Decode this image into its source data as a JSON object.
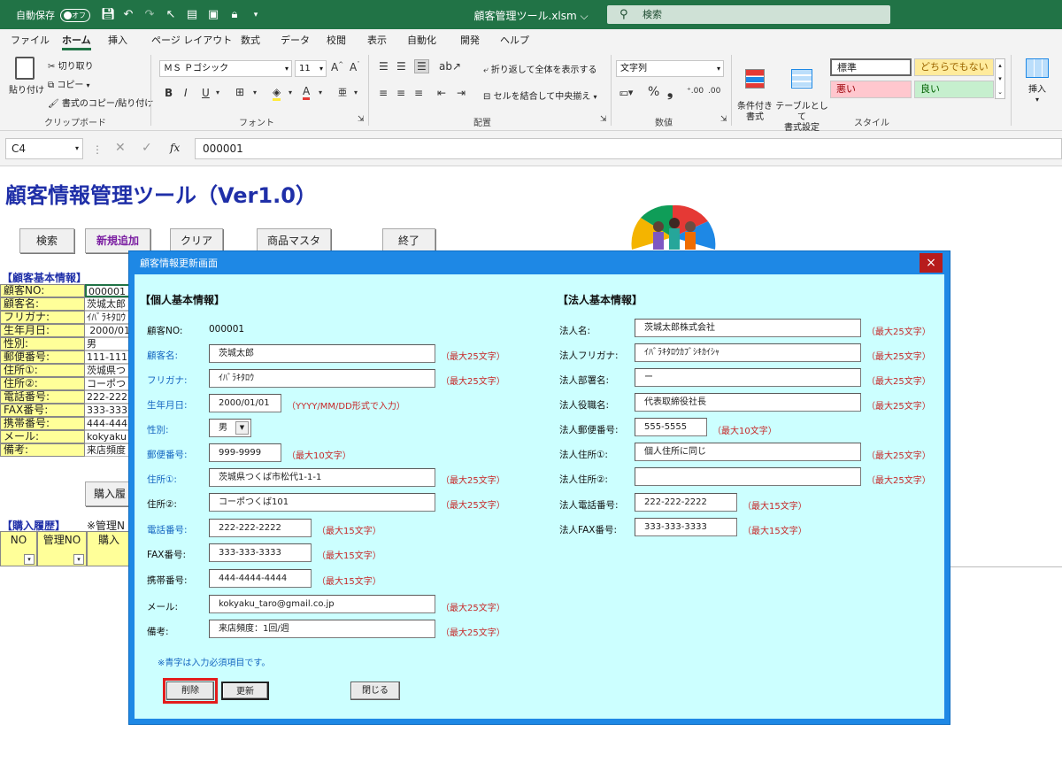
{
  "titlebar": {
    "autosave_label": "自動保存",
    "autosave_state": "オフ",
    "document_title": "顧客管理ツール.xlsm ⌵",
    "search_placeholder": "検索",
    "bg_color": "#217346"
  },
  "menu": {
    "tabs": [
      "ファイル",
      "ホーム",
      "挿入",
      "ページ レイアウト",
      "数式",
      "データ",
      "校閲",
      "表示",
      "自動化",
      "開発",
      "ヘルプ"
    ],
    "active_tab": "ホーム"
  },
  "ribbon": {
    "clipboard": {
      "paste": "貼り付け",
      "cut": "切り取り",
      "copy": "コピー",
      "format_painter": "書式のコピー/貼り付け",
      "group_label": "クリップボード"
    },
    "font": {
      "font_name": "ＭＳ Ｐゴシック",
      "font_size": "11",
      "group_label": "フォント"
    },
    "alignment": {
      "wrap_text": "折り返して全体を表示する",
      "merge_center": "セルを結合して中央揃え",
      "group_label": "配置"
    },
    "number": {
      "format": "文字列",
      "group_label": "数値"
    },
    "styles": {
      "conditional": "条件付き\n書式",
      "table": "テーブルとして\n書式設定",
      "standard": "標準",
      "neutral": "どちらでもない",
      "bad": "悪い",
      "good": "良い",
      "group_label": "スタイル"
    },
    "insert": "挿入"
  },
  "formula_bar": {
    "name_box": "C4",
    "fx": "fx",
    "value": "000001"
  },
  "sheet": {
    "title": "顧客情報管理ツール（Ver1.0）",
    "buttons": [
      "検索",
      "新規追加",
      "クリア",
      "商品マスタ",
      "終了"
    ],
    "basic_section": "【顧客基本情報】",
    "rows": [
      {
        "label": "顧客NO:",
        "value": "000001"
      },
      {
        "label": "顧客名:",
        "value": "茨城太郎"
      },
      {
        "label": "フリガナ:",
        "value": "ｲﾊﾞﾗｷﾀﾛｳ"
      },
      {
        "label": "生年月日:",
        "value": "2000/01"
      },
      {
        "label": "性別:",
        "value": "男"
      },
      {
        "label": "郵便番号:",
        "value": "111-111"
      },
      {
        "label": "住所①:",
        "value": "茨城県つ"
      },
      {
        "label": "住所②:",
        "value": "コーポつ"
      },
      {
        "label": "電話番号:",
        "value": "222-222"
      },
      {
        "label": "FAX番号:",
        "value": "333-333"
      },
      {
        "label": "携帯番号:",
        "value": "444-444"
      },
      {
        "label": "メール:",
        "value": "kokyaku"
      },
      {
        "label": "備考:",
        "value": "来店頻度"
      }
    ],
    "purchase_button": "購入履",
    "history_section": "【購入履歴】",
    "history_note": "※管理N",
    "history_headers": [
      "NO",
      "管理NO",
      "購入"
    ]
  },
  "dialog": {
    "title": "顧客情報更新画面",
    "personal_section": "【個人基本情報】",
    "corporate_section": "【法人基本情報】",
    "personal": {
      "customer_no_label": "顧客NO:",
      "customer_no": "000001",
      "name_label": "顧客名:",
      "name": "茨城太郎",
      "name_hint": "（最大25文字）",
      "kana_label": "フリガナ:",
      "kana": "ｲﾊﾞﾗｷﾀﾛｳ",
      "kana_hint": "（最大25文字）",
      "birth_label": "生年月日:",
      "birth": "2000/01/01",
      "birth_hint": "（YYYY/MM/DD形式で入力）",
      "gender_label": "性別:",
      "gender": "男",
      "zip_label": "郵便番号:",
      "zip": "999-9999",
      "zip_hint": "（最大10文字）",
      "addr1_label": "住所①:",
      "addr1": "茨城県つくば市松代1-1-1",
      "addr1_hint": "（最大25文字）",
      "addr2_label": "住所②:",
      "addr2": "コーポつくば101",
      "addr2_hint": "（最大25文字）",
      "tel_label": "電話番号:",
      "tel": "222-222-2222",
      "tel_hint": "（最大15文字）",
      "fax_label": "FAX番号:",
      "fax": "333-333-3333",
      "fax_hint": "（最大15文字）",
      "mobile_label": "携帯番号:",
      "mobile": "444-4444-4444",
      "mobile_hint": "（最大15文字）",
      "mail_label": "メール:",
      "mail": "kokyaku_taro@gmail.co.jp",
      "mail_hint": "（最大25文字）",
      "memo_label": "備考:",
      "memo": "来店頻度：1回/週",
      "memo_hint": "（最大25文字）"
    },
    "corporate": {
      "name_label": "法人名:",
      "name": "茨城太郎株式会社",
      "name_hint": "（最大25文字）",
      "kana_label": "法人フリガナ:",
      "kana": "ｲﾊﾞﾗｷﾀﾛｳｶﾌﾞｼｷｶｲｼｬ",
      "kana_hint": "（最大25文字）",
      "dept_label": "法人部署名:",
      "dept": "ー",
      "dept_hint": "（最大25文字）",
      "position_label": "法人役職名:",
      "position": "代表取締役社長",
      "position_hint": "（最大25文字）",
      "zip_label": "法人郵便番号:",
      "zip": "555-5555",
      "zip_hint": "（最大10文字）",
      "addr1_label": "法人住所①:",
      "addr1": "個人住所に同じ",
      "addr1_hint": "（最大25文字）",
      "addr2_label": "法人住所②:",
      "addr2": "",
      "addr2_hint": "（最大25文字）",
      "tel_label": "法人電話番号:",
      "tel": "222-222-2222",
      "tel_hint": "（最大15文字）",
      "fax_label": "法人FAX番号:",
      "fax": "333-333-3333",
      "fax_hint": "（最大15文字）"
    },
    "note": "※青字は入力必須項目です。",
    "delete_button": "削除",
    "update_button": "更新",
    "close_button": "閉じる",
    "close_x": "×"
  }
}
